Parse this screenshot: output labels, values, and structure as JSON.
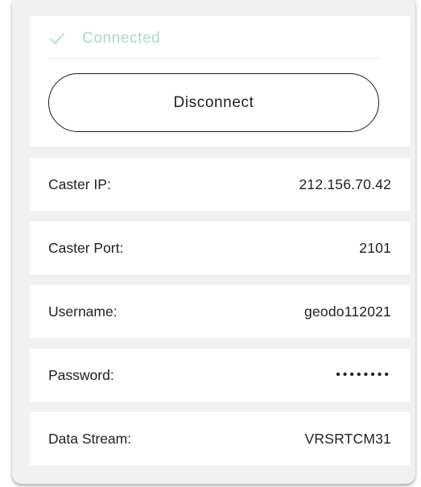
{
  "status": {
    "text": "Connected",
    "icon": "check-icon",
    "color": "#a6dccb"
  },
  "actions": {
    "disconnect_label": "Disconnect"
  },
  "fields": [
    {
      "label": "Caster IP:",
      "value": "212.156.70.42"
    },
    {
      "label": "Caster Port:",
      "value": "2101"
    },
    {
      "label": "Username:",
      "value": "geodo112021"
    },
    {
      "label": "Password:",
      "value": "••••••••"
    },
    {
      "label": "Data Stream:",
      "value": "VRSRTCM31"
    }
  ]
}
